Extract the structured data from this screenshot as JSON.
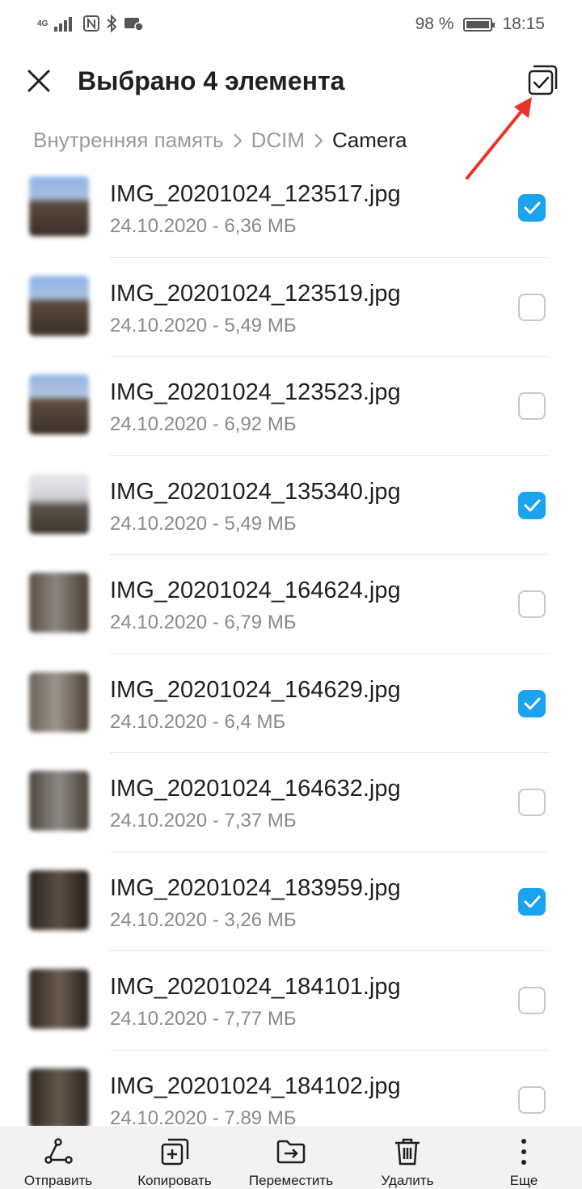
{
  "status_bar": {
    "network": "4G",
    "battery": "98 %",
    "battery_level": 0.98,
    "time": "18:15"
  },
  "header": {
    "title": "Выбрано 4 элемента",
    "close_icon": "close-icon",
    "select_all_icon": "select-all-icon"
  },
  "breadcrumb": {
    "items": [
      "Внутренняя память",
      "DCIM",
      "Camera"
    ]
  },
  "files": [
    {
      "name": "IMG_20201024_123517.jpg",
      "meta": "24.10.2020 - 6,36 МБ",
      "checked": true
    },
    {
      "name": "IMG_20201024_123519.jpg",
      "meta": "24.10.2020 - 5,49 МБ",
      "checked": false
    },
    {
      "name": "IMG_20201024_123523.jpg",
      "meta": "24.10.2020 - 6,92 МБ",
      "checked": false
    },
    {
      "name": "IMG_20201024_135340.jpg",
      "meta": "24.10.2020 - 5,49 МБ",
      "checked": true
    },
    {
      "name": "IMG_20201024_164624.jpg",
      "meta": "24.10.2020 - 6,79 МБ",
      "checked": false
    },
    {
      "name": "IMG_20201024_164629.jpg",
      "meta": "24.10.2020 - 6,4 МБ",
      "checked": true
    },
    {
      "name": "IMG_20201024_164632.jpg",
      "meta": "24.10.2020 - 7,37 МБ",
      "checked": false
    },
    {
      "name": "IMG_20201024_183959.jpg",
      "meta": "24.10.2020 - 3,26 МБ",
      "checked": true
    },
    {
      "name": "IMG_20201024_184101.jpg",
      "meta": "24.10.2020 - 7,77 МБ",
      "checked": false
    },
    {
      "name": "IMG_20201024_184102.jpg",
      "meta": "24.10.2020 - 7.89 МБ",
      "checked": false
    }
  ],
  "bottom_bar": {
    "actions": [
      {
        "label": "Отправить",
        "icon": "share-icon"
      },
      {
        "label": "Копировать",
        "icon": "copy-icon"
      },
      {
        "label": "Переместить",
        "icon": "move-icon"
      },
      {
        "label": "Удалить",
        "icon": "delete-icon"
      },
      {
        "label": "Еще",
        "icon": "more-icon"
      }
    ]
  },
  "colors": {
    "accent": "#1aa3f0",
    "annotation": "#e8332a",
    "bottom_bar_bg": "#f2f2f2"
  }
}
